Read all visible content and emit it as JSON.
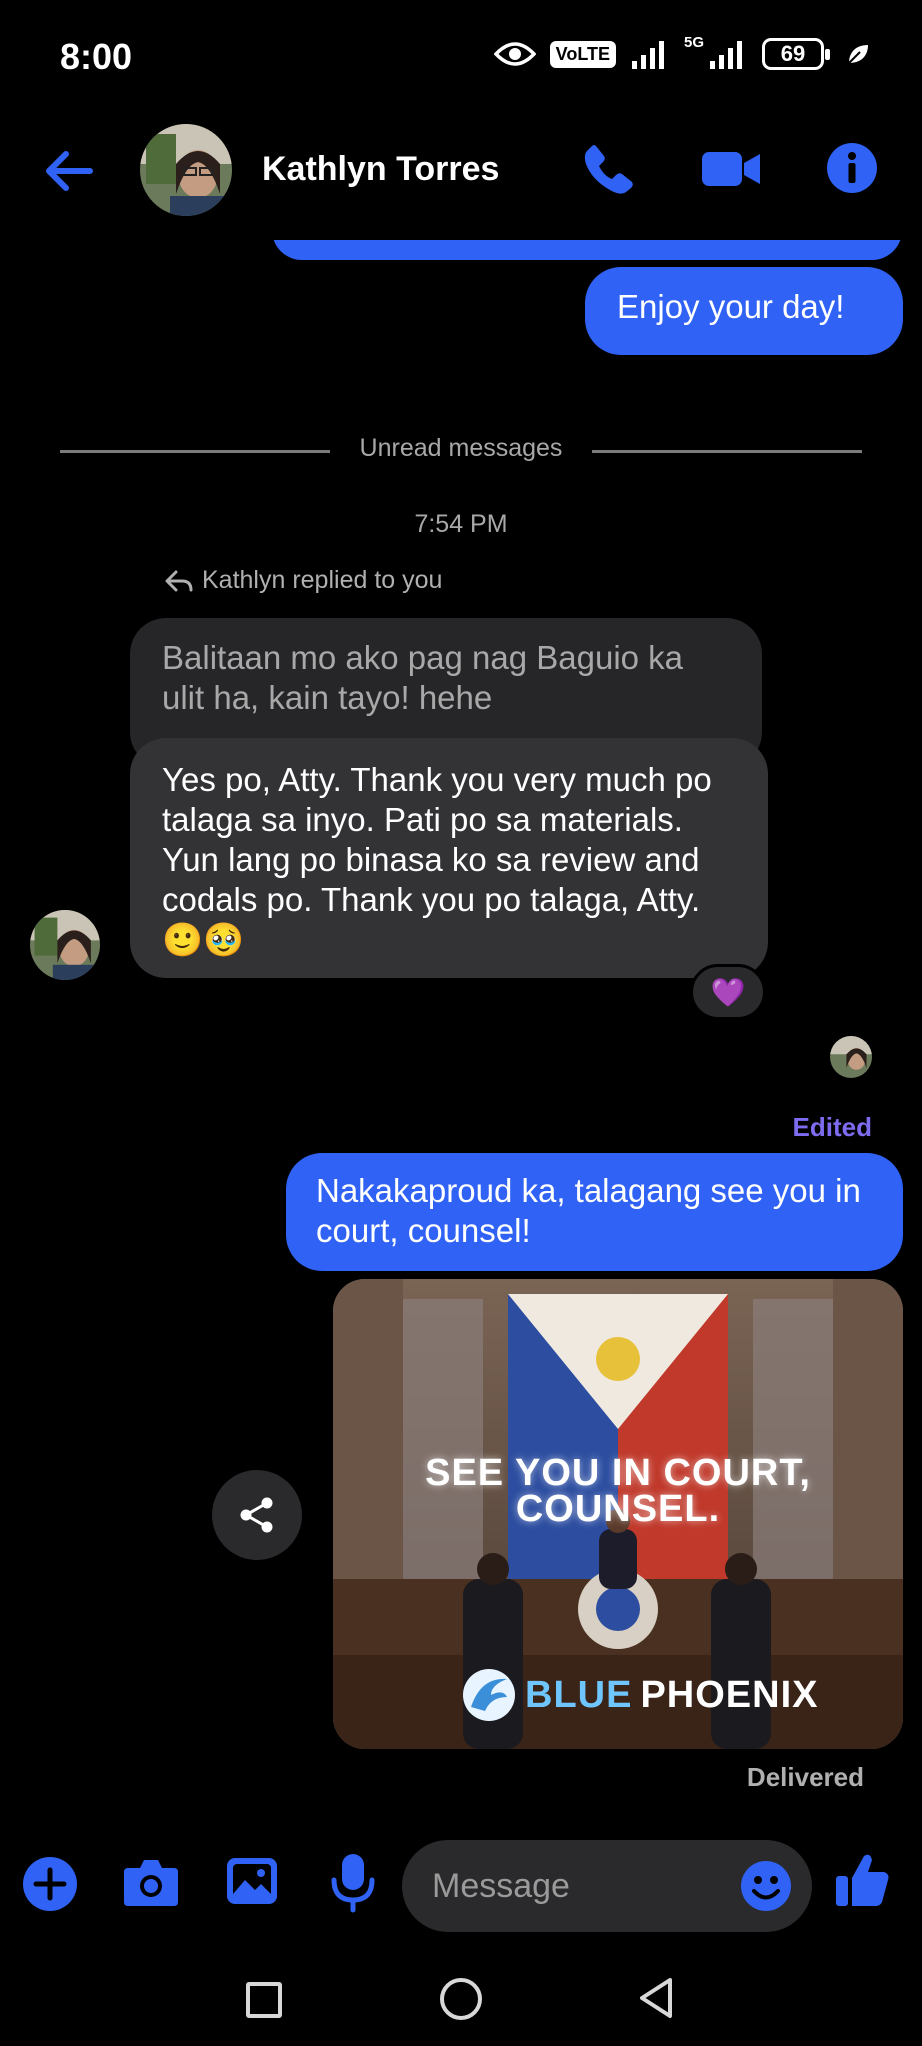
{
  "status_bar": {
    "time": "8:00",
    "volte": "VoLTE",
    "network": "5G",
    "battery": "69"
  },
  "header": {
    "contact_name": "Kathlyn Torres"
  },
  "chat": {
    "prev_message": "Enjoy your day!",
    "unread_label": "Unread messages",
    "timestamp": "7:54 PM",
    "reply_info": "Kathlyn replied to you",
    "quoted_message": "Balitaan mo ako pag nag Baguio ka ulit ha, kain tayo! hehe",
    "reply_message": "Yes po, Atty. Thank you very much po talaga sa inyo. Pati po sa materials. Yun lang po binasa ko sa review and codals po. Thank you po talaga, Atty. 🙂🥹",
    "reaction": "💜",
    "edited_label": "Edited",
    "sent_message": "Nakakaproud ka, talagang see you in court, counsel!",
    "media": {
      "title_line1": "SEE YOU IN COURT,",
      "title_line2": "COUNSEL.",
      "brand_part1": "BLUE",
      "brand_part2": "PHOENIX"
    },
    "delivered_label": "Delivered"
  },
  "composer": {
    "placeholder": "Message"
  },
  "colors": {
    "accent": "#2f62f5",
    "background": "#000000",
    "incoming_bubble": "#333336",
    "edited": "#7d6cf0"
  },
  "icons": [
    "eye-icon",
    "signal-icon",
    "back-arrow-icon",
    "phone-icon",
    "video-icon",
    "info-icon",
    "reply-icon",
    "share-icon",
    "plus-icon",
    "camera-icon",
    "gallery-icon",
    "mic-icon",
    "emoji-icon",
    "thumbs-up-icon"
  ]
}
